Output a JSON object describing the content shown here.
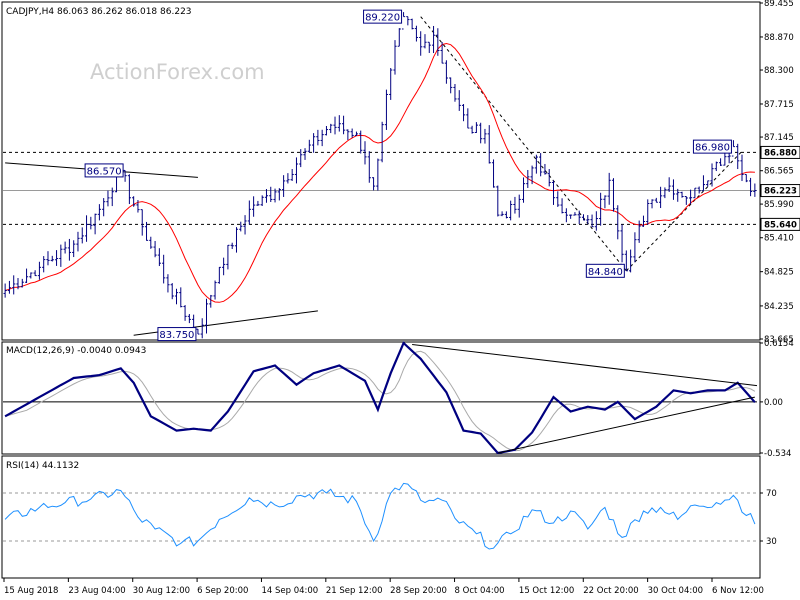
{
  "chart_data": [
    {
      "type": "line",
      "panel": "price",
      "title": "CADJPY,H4  86.063 86.262 86.018 86.223",
      "symbol": "CADJPY",
      "timeframe": "H4",
      "ohlc_header": {
        "open": 86.063,
        "high": 86.262,
        "low": 86.018,
        "close": 86.223
      },
      "watermark": "ActionForex.com",
      "ylim": [
        83.665,
        89.455
      ],
      "y_ticks": [
        89.455,
        88.87,
        88.3,
        87.715,
        87.145,
        86.565,
        85.99,
        85.41,
        84.825,
        84.235,
        83.665
      ],
      "x_ticks": [
        "15 Aug 2018",
        "23 Aug 04:00",
        "30 Aug 12:00",
        "6 Sep 20:00",
        "14 Sep 04:00",
        "21 Sep 12:00",
        "28 Sep 20:00",
        "8 Oct 04:00",
        "15 Oct 12:00",
        "22 Oct 20:00",
        "30 Oct 04:00",
        "6 Nov 12:00"
      ],
      "grid": false,
      "anchors": [
        {
          "bar": 0,
          "price": 84.5
        },
        {
          "bar": 8,
          "price": 84.9
        },
        {
          "bar": 16,
          "price": 85.3
        },
        {
          "bar": 22,
          "price": 85.9
        },
        {
          "bar": 27,
          "price": 86.57
        },
        {
          "bar": 32,
          "price": 85.6
        },
        {
          "bar": 38,
          "price": 84.6
        },
        {
          "bar": 45,
          "price": 83.75
        },
        {
          "bar": 50,
          "price": 84.9
        },
        {
          "bar": 57,
          "price": 85.9
        },
        {
          "bar": 63,
          "price": 86.2
        },
        {
          "bar": 70,
          "price": 86.9
        },
        {
          "bar": 76,
          "price": 87.35
        },
        {
          "bar": 82,
          "price": 87.2
        },
        {
          "bar": 86,
          "price": 86.3
        },
        {
          "bar": 90,
          "price": 88.3
        },
        {
          "bar": 93,
          "price": 89.22
        },
        {
          "bar": 97,
          "price": 88.7
        },
        {
          "bar": 100,
          "price": 88.9
        },
        {
          "bar": 104,
          "price": 88.0
        },
        {
          "bar": 108,
          "price": 87.3
        },
        {
          "bar": 112,
          "price": 87.2
        },
        {
          "bar": 115,
          "price": 85.8
        },
        {
          "bar": 119,
          "price": 85.9
        },
        {
          "bar": 124,
          "price": 86.8
        },
        {
          "bar": 128,
          "price": 86.1
        },
        {
          "bar": 132,
          "price": 85.8
        },
        {
          "bar": 137,
          "price": 85.6
        },
        {
          "bar": 141,
          "price": 86.4
        },
        {
          "bar": 145,
          "price": 84.84
        },
        {
          "bar": 150,
          "price": 86.0
        },
        {
          "bar": 155,
          "price": 86.3
        },
        {
          "bar": 160,
          "price": 86.1
        },
        {
          "bar": 165,
          "price": 86.6
        },
        {
          "bar": 170,
          "price": 86.98
        },
        {
          "bar": 172,
          "price": 86.5
        },
        {
          "bar": 175,
          "price": 86.223
        }
      ],
      "moving_average": {
        "color": "#ff0000",
        "period_bars": 14
      },
      "price_color": "#000080",
      "annotations": [
        {
          "label": "89.220",
          "bar": 93,
          "price": 89.22,
          "box_position": "left"
        },
        {
          "label": "86.570",
          "bar": 28,
          "price": 86.57,
          "box_position": "left"
        },
        {
          "label": "83.750",
          "bar": 45,
          "price": 83.75,
          "box_position": "left"
        },
        {
          "label": "84.840",
          "bar": 145,
          "price": 84.84,
          "box_position": "left"
        },
        {
          "label": "86.980",
          "bar": 170,
          "price": 86.98,
          "box_position": "left"
        }
      ],
      "horizontal_levels": [
        {
          "price": 86.88,
          "label": "86.880",
          "style": "dashed"
        },
        {
          "price": 86.223,
          "label": "86.223",
          "style": "solid-grey"
        },
        {
          "price": 85.64,
          "label": "85.640",
          "style": "dashed"
        }
      ],
      "trendlines": [
        {
          "style": "solid",
          "from": {
            "bar": 0,
            "price": 86.7
          },
          "to": {
            "bar": 45,
            "price": 86.45
          }
        },
        {
          "style": "solid",
          "from": {
            "bar": 30,
            "price": 83.73
          },
          "to": {
            "bar": 73,
            "price": 84.15
          }
        },
        {
          "style": "dashed",
          "from": {
            "bar": 97,
            "price": 89.22
          },
          "to": {
            "bar": 145,
            "price": 84.84
          }
        },
        {
          "style": "dashed",
          "from": {
            "bar": 145,
            "price": 84.84
          },
          "to": {
            "bar": 172,
            "price": 86.9
          }
        }
      ]
    },
    {
      "type": "line",
      "panel": "macd",
      "title": "MACD(12,26,9) -0.0040 0.0943",
      "params": [
        12,
        26,
        9
      ],
      "values_shown": [
        -0.004,
        0.0943
      ],
      "ylim": [
        -0.534,
        0.6154
      ],
      "y_ticks": [
        0.6154,
        0.0,
        -0.534
      ],
      "y_tick_labels": [
        "0.6154",
        "0.00",
        "-0.534"
      ],
      "zero_line": true,
      "macd_color": "#000080",
      "signal_color": "#aaaaaa",
      "anchors": [
        {
          "bar": 0,
          "value": -0.15
        },
        {
          "bar": 8,
          "value": 0.05
        },
        {
          "bar": 16,
          "value": 0.25
        },
        {
          "bar": 22,
          "value": 0.28
        },
        {
          "bar": 27,
          "value": 0.35
        },
        {
          "bar": 30,
          "value": 0.2
        },
        {
          "bar": 34,
          "value": -0.15
        },
        {
          "bar": 40,
          "value": -0.3
        },
        {
          "bar": 44,
          "value": -0.28
        },
        {
          "bar": 48,
          "value": -0.3
        },
        {
          "bar": 52,
          "value": -0.1
        },
        {
          "bar": 58,
          "value": 0.32
        },
        {
          "bar": 63,
          "value": 0.38
        },
        {
          "bar": 68,
          "value": 0.18
        },
        {
          "bar": 72,
          "value": 0.3
        },
        {
          "bar": 78,
          "value": 0.38
        },
        {
          "bar": 84,
          "value": 0.22
        },
        {
          "bar": 87,
          "value": -0.08
        },
        {
          "bar": 90,
          "value": 0.3
        },
        {
          "bar": 93,
          "value": 0.6154
        },
        {
          "bar": 97,
          "value": 0.45
        },
        {
          "bar": 103,
          "value": 0.1
        },
        {
          "bar": 107,
          "value": -0.3
        },
        {
          "bar": 111,
          "value": -0.33
        },
        {
          "bar": 115,
          "value": -0.534
        },
        {
          "bar": 119,
          "value": -0.5
        },
        {
          "bar": 123,
          "value": -0.32
        },
        {
          "bar": 128,
          "value": 0.05
        },
        {
          "bar": 132,
          "value": -0.1
        },
        {
          "bar": 136,
          "value": -0.05
        },
        {
          "bar": 140,
          "value": -0.08
        },
        {
          "bar": 143,
          "value": 0.0
        },
        {
          "bar": 147,
          "value": -0.18
        },
        {
          "bar": 152,
          "value": -0.05
        },
        {
          "bar": 156,
          "value": 0.12
        },
        {
          "bar": 160,
          "value": 0.09
        },
        {
          "bar": 164,
          "value": 0.12
        },
        {
          "bar": 168,
          "value": 0.12
        },
        {
          "bar": 171,
          "value": 0.2
        },
        {
          "bar": 175,
          "value": -0.004
        }
      ],
      "trendlines": [
        {
          "from": {
            "bar": 95,
            "value": 0.6
          },
          "to": {
            "bar": 180,
            "value": 0.17
          }
        },
        {
          "from": {
            "bar": 115,
            "value": -0.534
          },
          "to": {
            "bar": 175,
            "value": 0.05
          }
        }
      ]
    },
    {
      "type": "line",
      "panel": "rsi",
      "title": "RSI(14) 44.1132",
      "period": 14,
      "value_shown": 44.1132,
      "ylim": [
        0,
        100
      ],
      "y_ticks": [
        70,
        30
      ],
      "y_tick_labels": [
        "70",
        "30"
      ],
      "levels": [
        70,
        30
      ],
      "line_color": "#1e90ff",
      "anchors": [
        {
          "bar": 0,
          "value": 48
        },
        {
          "bar": 8,
          "value": 58
        },
        {
          "bar": 14,
          "value": 62
        },
        {
          "bar": 20,
          "value": 65
        },
        {
          "bar": 27,
          "value": 72
        },
        {
          "bar": 31,
          "value": 50
        },
        {
          "bar": 35,
          "value": 40
        },
        {
          "bar": 41,
          "value": 28
        },
        {
          "bar": 45,
          "value": 30
        },
        {
          "bar": 50,
          "value": 48
        },
        {
          "bar": 57,
          "value": 66
        },
        {
          "bar": 63,
          "value": 60
        },
        {
          "bar": 69,
          "value": 68
        },
        {
          "bar": 75,
          "value": 70
        },
        {
          "bar": 82,
          "value": 63
        },
        {
          "bar": 86,
          "value": 30
        },
        {
          "bar": 90,
          "value": 70
        },
        {
          "bar": 93,
          "value": 78
        },
        {
          "bar": 98,
          "value": 62
        },
        {
          "bar": 102,
          "value": 64
        },
        {
          "bar": 106,
          "value": 45
        },
        {
          "bar": 110,
          "value": 36
        },
        {
          "bar": 114,
          "value": 24
        },
        {
          "bar": 118,
          "value": 36
        },
        {
          "bar": 123,
          "value": 56
        },
        {
          "bar": 128,
          "value": 45
        },
        {
          "bar": 132,
          "value": 55
        },
        {
          "bar": 136,
          "value": 40
        },
        {
          "bar": 140,
          "value": 58
        },
        {
          "bar": 144,
          "value": 33
        },
        {
          "bar": 149,
          "value": 55
        },
        {
          "bar": 153,
          "value": 58
        },
        {
          "bar": 157,
          "value": 48
        },
        {
          "bar": 161,
          "value": 60
        },
        {
          "bar": 166,
          "value": 62
        },
        {
          "bar": 170,
          "value": 68
        },
        {
          "bar": 175,
          "value": 44.1132
        }
      ]
    }
  ]
}
